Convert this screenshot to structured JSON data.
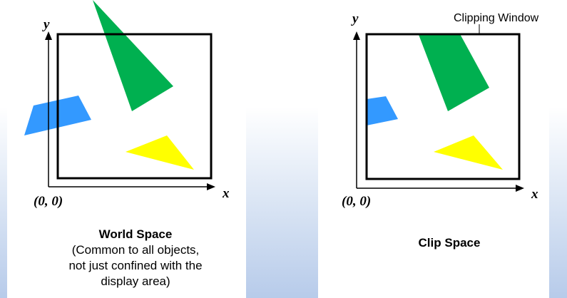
{
  "world_space": {
    "y_label": "y",
    "x_label": "x",
    "origin_label": "(0, 0)",
    "title": "World Space",
    "subtitle": [
      "(Common to all objects,",
      "not just confined with the",
      "display area)"
    ]
  },
  "clip_space": {
    "y_label": "y",
    "x_label": "x",
    "origin_label": "(0, 0)",
    "title": "Clip Space",
    "window_label": "Clipping Window"
  },
  "colors": {
    "green": "#00b050",
    "blue": "#3399ff",
    "yellow": "#ffff00",
    "axis": "#000000"
  }
}
